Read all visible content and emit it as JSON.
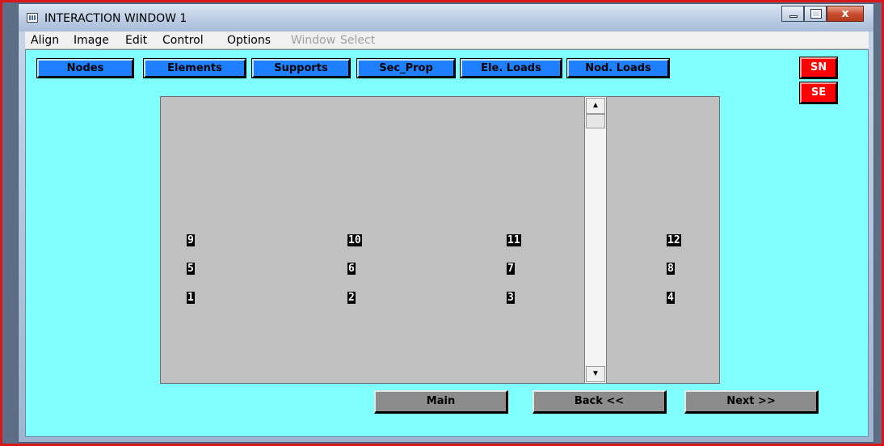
{
  "window": {
    "title": "INTERACTION WINDOW 1",
    "caption_buttons": [
      "minimize-icon",
      "maximize-icon",
      "close-icon"
    ],
    "close_glyph": "x"
  },
  "menu": {
    "items": [
      {
        "label": "Align",
        "enabled": true
      },
      {
        "label": "Image",
        "enabled": true
      },
      {
        "label": "Edit",
        "enabled": true
      },
      {
        "label": "Control",
        "enabled": true
      },
      {
        "label": "Options",
        "enabled": true
      },
      {
        "label": "Window",
        "enabled": false
      },
      {
        "label": "Select",
        "enabled": false
      }
    ]
  },
  "toolbar": {
    "buttons": [
      "Nodes",
      "Elements",
      "Supports",
      "Sec_Prop",
      "Ele. Loads",
      "Nod. Loads"
    ],
    "button_color": "#1e7fff"
  },
  "side_buttons": {
    "sn": "SN",
    "se": "SE",
    "color": "#ff0000"
  },
  "canvas": {
    "background": "#c0c0c0",
    "nodes": [
      {
        "id": "9"
      },
      {
        "id": "10"
      },
      {
        "id": "11"
      },
      {
        "id": "12"
      },
      {
        "id": "5"
      },
      {
        "id": "6"
      },
      {
        "id": "7"
      },
      {
        "id": "8"
      },
      {
        "id": "1"
      },
      {
        "id": "2"
      },
      {
        "id": "3"
      },
      {
        "id": "4"
      }
    ],
    "scroll_up_icon": "▲",
    "scroll_down_icon": "▼"
  },
  "nav": {
    "main": "Main",
    "back": "Back <<",
    "next": "Next >>"
  },
  "colors": {
    "client_background": "#80ffff",
    "frame_red": "#d81818"
  }
}
